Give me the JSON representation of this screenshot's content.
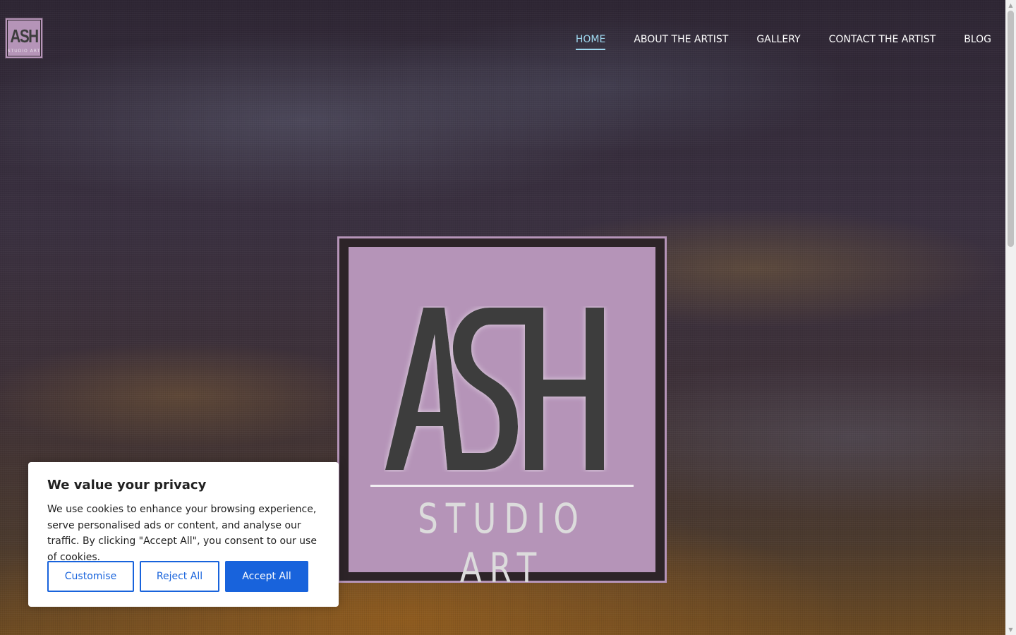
{
  "header": {
    "logo": {
      "mark": "ASH",
      "subtitle": "STUDIO ART"
    },
    "nav": [
      {
        "label": "HOME",
        "active": true
      },
      {
        "label": "ABOUT THE ARTIST",
        "active": false
      },
      {
        "label": "GALLERY",
        "active": false
      },
      {
        "label": "CONTACT THE ARTIST",
        "active": false
      },
      {
        "label": "BLOG",
        "active": false
      }
    ]
  },
  "hero": {
    "logo": {
      "mark": "ASH",
      "subtitle": "STUDIO ART"
    }
  },
  "cookie_banner": {
    "title": "We value your privacy",
    "message": "We use cookies to enhance your browsing experience, serve personalised ads or content, and analyse our traffic. By clicking \"Accept All\", you consent to our use of cookies.",
    "buttons": {
      "customise": "Customise",
      "reject": "Reject All",
      "accept": "Accept All"
    }
  },
  "colors": {
    "brand_mauve": "#b594b8",
    "logo_dark": "#3d3d3d",
    "nav_active": "#9fd8f0",
    "button_blue": "#1863dc"
  },
  "icons": {
    "scroll_up": "triangle-up-icon",
    "scroll_down": "triangle-down-icon"
  }
}
